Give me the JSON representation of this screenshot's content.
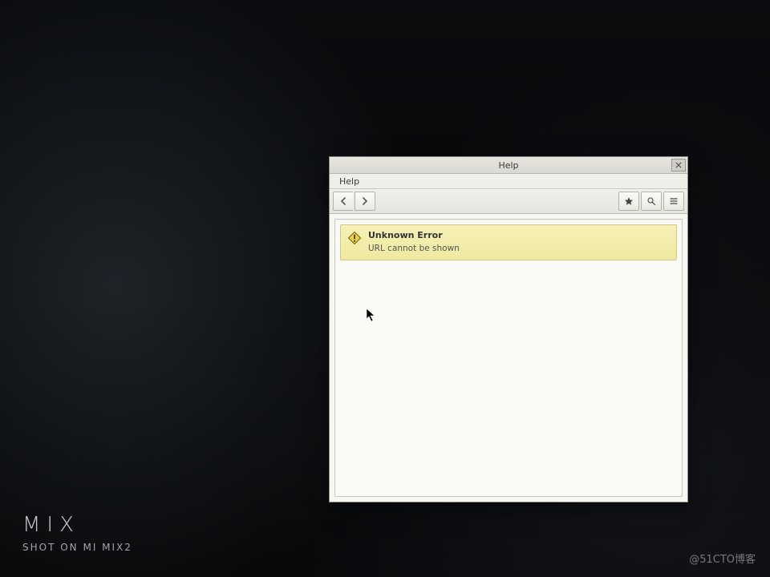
{
  "window": {
    "title": "Help",
    "close_label": "Close"
  },
  "menubar": {
    "items": [
      {
        "label": "Help"
      }
    ]
  },
  "toolbar": {
    "back_label": "Back",
    "forward_label": "Forward",
    "bookmark_label": "Bookmark",
    "search_label": "Search",
    "menu_label": "Menu"
  },
  "error": {
    "title": "Unknown Error",
    "message": "URL cannot be shown"
  },
  "watermark": {
    "brand": "MIX",
    "device": "SHOT ON MI MIX2",
    "blog": "@51CTO博客"
  }
}
